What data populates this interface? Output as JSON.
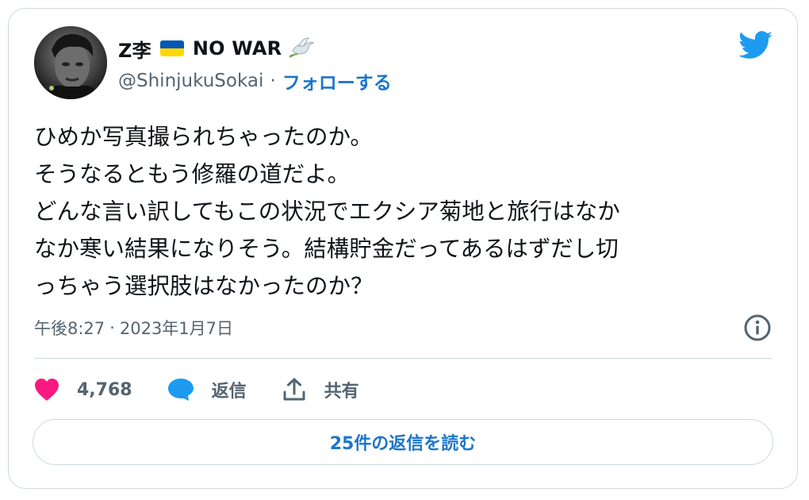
{
  "author": {
    "name": "Z李",
    "name_suffix": "NO WAR",
    "handle": "@ShinjukuSokai",
    "separator": "·",
    "follow_label": "フォローする"
  },
  "tweet": {
    "text": "ひめか写真撮られちゃったのか。\nそうなるともう修羅の道だよ。\nどんな言い訳してもこの状況でエクシア菊地と旅行はなか\nなか寒い結果になりそう。結構貯金だってあるはずだし切\nっちゃう選択肢はなかったのか？",
    "time": "午後8:27",
    "separator": "·",
    "date": "2023年1月7日"
  },
  "actions": {
    "like_count": "4,768",
    "reply_label": "返信",
    "share_label": "共有"
  },
  "read_replies_label": "25件の返信を読む",
  "colors": {
    "link": "#1d75c9",
    "twitter_blue": "#1d9bf0",
    "like_red": "#f91880",
    "muted": "#536471",
    "border": "#cfd9de"
  },
  "icons": {
    "brand": "twitter-bird-icon",
    "info": "info-icon",
    "like": "heart-icon",
    "reply": "speech-bubble-icon",
    "share": "share-upload-icon",
    "flag": "ukraine-flag-icon",
    "emoji": "dove-icon"
  }
}
